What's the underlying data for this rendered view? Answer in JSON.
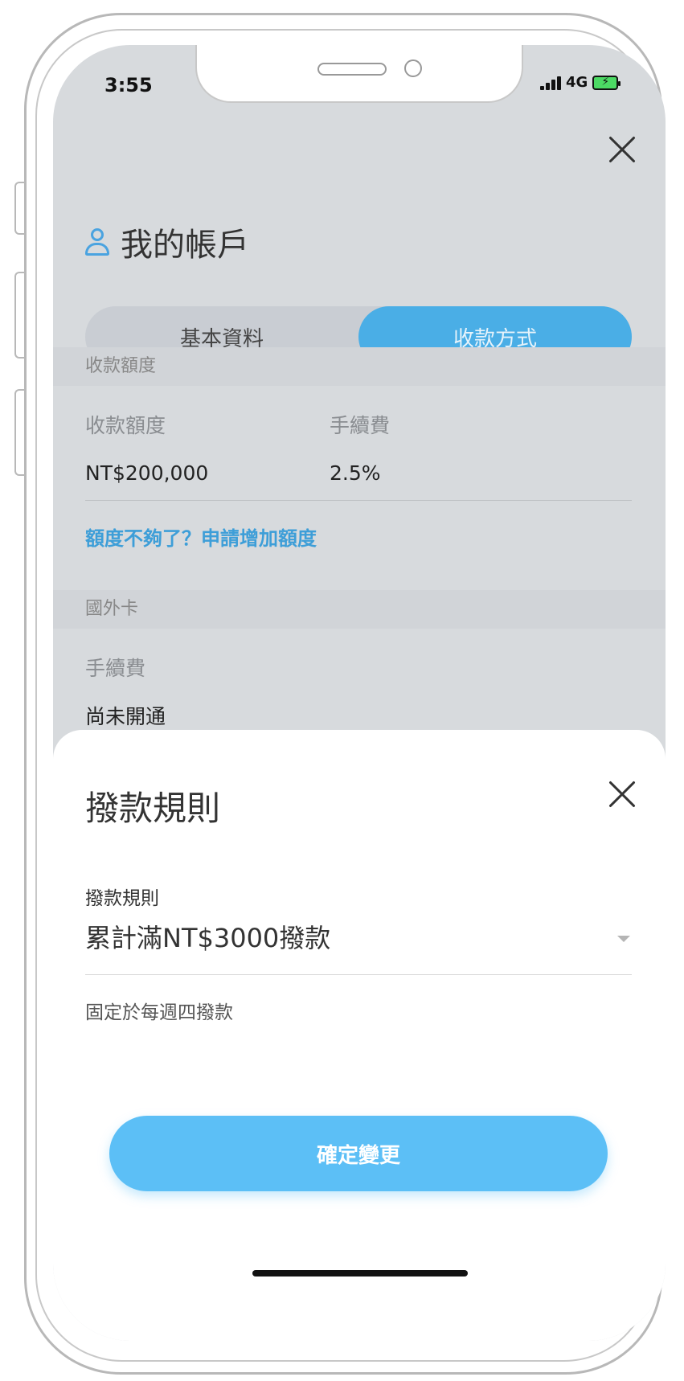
{
  "status_bar": {
    "time": "3:55",
    "network": "4G"
  },
  "account": {
    "title": "我的帳戶"
  },
  "tabs": [
    {
      "label": "基本資料",
      "active": false
    },
    {
      "label": "收款方式",
      "active": true
    }
  ],
  "limit_section": {
    "header": "收款額度",
    "limit_label": "收款額度",
    "limit_value": "NT$200,000",
    "fee_label": "手續費",
    "fee_value": "2.5%",
    "increase_link": "額度不夠了？申請增加額度"
  },
  "foreign_section": {
    "header": "國外卡",
    "fee_label": "手續費",
    "fee_value": "尚未開通"
  },
  "sheet": {
    "title": "撥款規則",
    "field_label": "撥款規則",
    "selected_value": "累計滿NT$3000撥款",
    "helper_text": "固定於每週四撥款",
    "confirm_label": "確定變更"
  },
  "colors": {
    "accent": "#4aaee6",
    "button": "#5cbff6",
    "link": "#3d9ed8",
    "overlay_bg": "#d7dadd"
  }
}
